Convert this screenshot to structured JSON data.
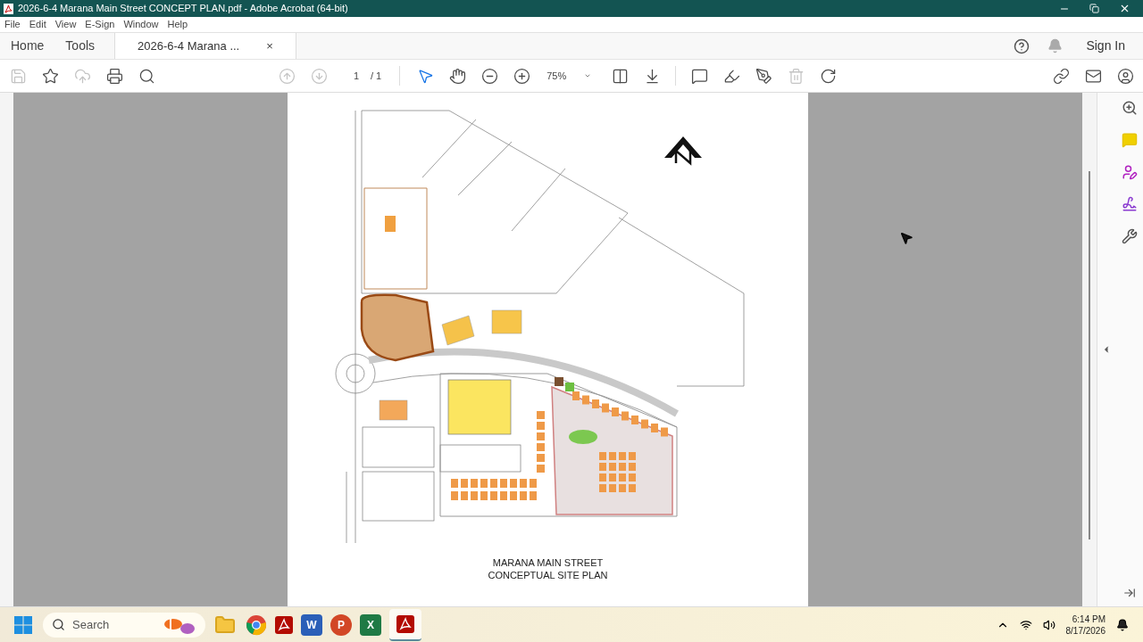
{
  "window": {
    "title": "2026-6-4 Marana Main Street CONCEPT PLAN.pdf - Adobe Acrobat (64-bit)"
  },
  "menu": [
    "File",
    "Edit",
    "View",
    "E-Sign",
    "Window",
    "Help"
  ],
  "tabs": [
    {
      "label": "Home",
      "selected": false,
      "closable": false
    },
    {
      "label": "Tools",
      "selected": false,
      "closable": false
    },
    {
      "label": "2026-6-4 Marana ...",
      "selected": true,
      "closable": true
    }
  ],
  "tab_close": "×",
  "header": {
    "sign_in": "Sign In"
  },
  "toolbar": {
    "page": "1",
    "page_total": "/ 1",
    "zoom": "75%"
  },
  "document": {
    "caption": [
      "MARANA MAIN STREET",
      "CONCEPTUAL SITE PLAN"
    ]
  },
  "taskbar": {
    "search_placeholder": "Search",
    "apps": [
      {
        "kind": "folder"
      },
      {
        "kind": "chrome"
      },
      {
        "kind": "acrobat"
      },
      {
        "kind": "word",
        "glyph": "W"
      },
      {
        "kind": "powerpoint",
        "glyph": "P"
      },
      {
        "kind": "excel",
        "glyph": "X"
      },
      {
        "kind": "acrobat-active"
      }
    ],
    "time": "6:14 PM",
    "date": "8/17/2026"
  }
}
